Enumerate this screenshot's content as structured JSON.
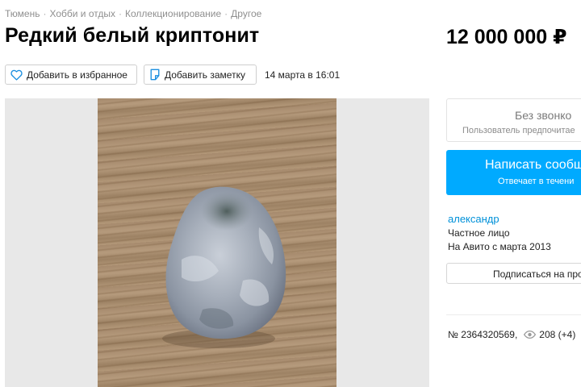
{
  "breadcrumbs": [
    "Тюмень",
    "Хобби и отдых",
    "Коллекционирование",
    "Другое"
  ],
  "breadcrumb_separator": "·",
  "title": "Редкий белый криптонит",
  "price": "12 000 000 ₽",
  "actions": {
    "favorite_label": "Добавить в избранное",
    "note_label": "Добавить заметку",
    "date": "14 марта в 16:01"
  },
  "icons": {
    "favorite": "heart-icon",
    "note": "note-icon",
    "views": "eye-icon"
  },
  "colors": {
    "accent": "#00aaff",
    "link": "#0091d9",
    "icon_blue": "#1b8fe0"
  },
  "sidebar": {
    "no_calls_title": "Без звонко",
    "no_calls_subtitle": "Пользователь предпочитае",
    "write_title": "Написать сообщ",
    "write_subtitle": "Отвечает в течени",
    "seller_name": "александр",
    "seller_type": "Частное лицо",
    "seller_since": "На Авито с марта 2013",
    "subscribe_label": "Подписаться на про"
  },
  "meta": {
    "listing_number": "№ 2364320569,",
    "views": "208 (+4)"
  }
}
